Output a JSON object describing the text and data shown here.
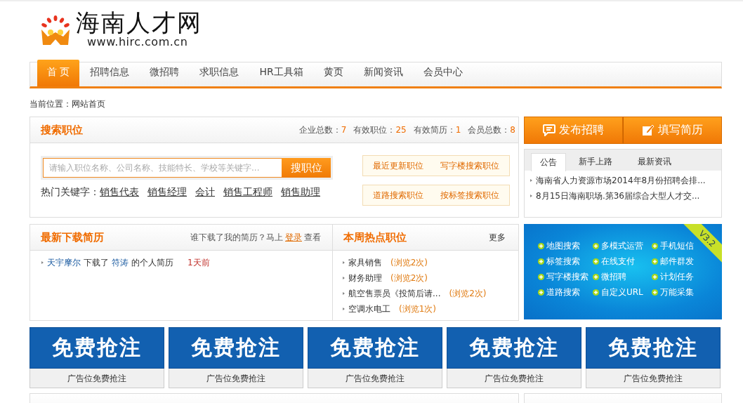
{
  "logo": {
    "name": "海南人才网",
    "url": "www.hirc.com.cn"
  },
  "nav": [
    {
      "label": "首 页",
      "selected": true
    },
    {
      "label": "招聘信息",
      "selected": false
    },
    {
      "label": "微招聘",
      "selected": false
    },
    {
      "label": "求职信息",
      "selected": false
    },
    {
      "label": "HR工具箱",
      "selected": false
    },
    {
      "label": "黄页",
      "selected": false
    },
    {
      "label": "新闻资讯",
      "selected": false
    },
    {
      "label": "会员中心",
      "selected": false
    }
  ],
  "breadcrumb": "当前位置：网站首页",
  "search_panel": {
    "title": "搜索职位",
    "stats": [
      {
        "label": "企业总数：",
        "value": "7"
      },
      {
        "label": "有效职位：",
        "value": "25"
      },
      {
        "label": "有效简历：",
        "value": "1"
      },
      {
        "label": "会员总数：",
        "value": "8"
      }
    ],
    "search": {
      "placeholder": "请输入职位名称、公司名称、技能特长、学校等关键字...",
      "button": "搜职位"
    },
    "hot_label": "热门关键字：",
    "hot_keywords": [
      "销售代表",
      "销售经理",
      "会计",
      "销售工程师",
      "销售助理"
    ],
    "quick_links": [
      "最近更新职位",
      "写字楼搜索职位",
      "道路搜索职位",
      "按标签搜索职位"
    ]
  },
  "actions": [
    {
      "kind": "post",
      "label": "发布招聘"
    },
    {
      "kind": "resume",
      "label": "填写简历"
    }
  ],
  "notice": {
    "tabs": [
      {
        "label": "公告",
        "selected": true
      },
      {
        "label": "新手上路",
        "selected": false
      },
      {
        "label": "最新资讯",
        "selected": false
      }
    ],
    "items": [
      "海南省人力资源市场2014年8月份招聘会排...",
      "8月15日海南职场.第36届综合大型人才交..."
    ]
  },
  "downloads": {
    "title": "最新下载简历",
    "prompt": "谁下载了我的简历？马上",
    "login": "登录",
    "prompt_end": "查看",
    "items": [
      {
        "company": "天宇摩尔",
        "action": "下载了",
        "person": "符涛",
        "suffix": "的个人简历",
        "time": "1天前"
      }
    ]
  },
  "hot_jobs": {
    "title": "本周热点职位",
    "more": "更多",
    "items": [
      {
        "name": "家具销售",
        "views": "(浏览2次)"
      },
      {
        "name": "财务助理",
        "views": "(浏览2次)"
      },
      {
        "name": "航空售票员《投简后请...",
        "views": "(浏览2次)"
      },
      {
        "name": "空调水电工",
        "views": "(浏览1次)"
      }
    ]
  },
  "promo": {
    "version": "V3.2",
    "features": [
      "地图搜索",
      "多模式运营",
      "手机短信",
      "标签搜索",
      "在线支付",
      "邮件群发",
      "写字楼搜索",
      "微招聘",
      "计划任务",
      "道路搜索",
      "自定义URL",
      "万能采集"
    ]
  },
  "ads": [
    {
      "banner": "免费抢注",
      "caption": "广告位免费抢注"
    },
    {
      "banner": "免费抢注",
      "caption": "广告位免费抢注"
    },
    {
      "banner": "免费抢注",
      "caption": "广告位免费抢注"
    },
    {
      "banner": "免费抢注",
      "caption": "广告位免费抢注"
    },
    {
      "banner": "免费抢注",
      "caption": "广告位免费抢注"
    }
  ],
  "bottom": {
    "panels": [
      {
        "kind": "wide"
      },
      {
        "kind": "narrow"
      }
    ]
  }
}
